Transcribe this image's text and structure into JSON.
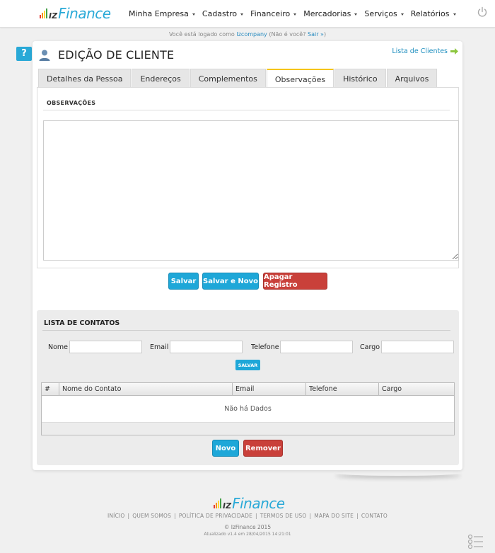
{
  "brand": {
    "logo_prefix": "IZ",
    "logo_name": "Finance"
  },
  "nav": {
    "items": [
      {
        "label": "Minha Empresa"
      },
      {
        "label": "Cadastro"
      },
      {
        "label": "Financeiro"
      },
      {
        "label": "Mercadorias"
      },
      {
        "label": "Serviços"
      },
      {
        "label": "Relatórios"
      }
    ]
  },
  "session": {
    "prefix": "Você está logado como",
    "user": "Izcompany",
    "not_you": "(Não é você?",
    "logout": "Sair »",
    "suffix": ")"
  },
  "page": {
    "help_label": "?",
    "title": "EDIÇÃO DE CLIENTE",
    "list_link": "Lista de Clientes"
  },
  "tabs": [
    {
      "label": "Detalhes da Pessoa"
    },
    {
      "label": "Endereços"
    },
    {
      "label": "Complementos"
    },
    {
      "label": "Observações"
    },
    {
      "label": "Histórico"
    },
    {
      "label": "Arquivos"
    }
  ],
  "observacoes": {
    "section_label": "OBSERVAÇÕES",
    "text": ""
  },
  "actions": {
    "save": "Salvar",
    "save_new": "Salvar e Novo",
    "delete": "Apagar Registro"
  },
  "contacts": {
    "title": "LISTA DE CONTATOS",
    "fields": {
      "nome": {
        "label": "Nome",
        "value": ""
      },
      "email": {
        "label": "Email",
        "value": ""
      },
      "telefone": {
        "label": "Telefone",
        "value": ""
      },
      "cargo": {
        "label": "Cargo",
        "value": ""
      }
    },
    "save_small": "SALVAR",
    "table": {
      "columns": [
        "#",
        "Nome do Contato",
        "Email",
        "Telefone",
        "Cargo"
      ],
      "empty": "Não há Dados"
    },
    "new_button": "Novo",
    "remove_button": "Remover"
  },
  "footer": {
    "links": [
      "INÍCIO",
      "QUEM SOMOS",
      "POLÍTICA DE PRIVACIDADE",
      "TERMOS DE USO",
      "MAPA DO SITE",
      "CONTATO"
    ],
    "separator": "|",
    "copyright": "© IzFinance 2015",
    "updated": "Atualizado v1.4 em 28/04/2015 14:21:01"
  },
  "colors": {
    "accent": "#1ea7d8",
    "danger": "#c9403a",
    "active_tab": "#f5c518",
    "logo_blue": "#29a9d7"
  }
}
